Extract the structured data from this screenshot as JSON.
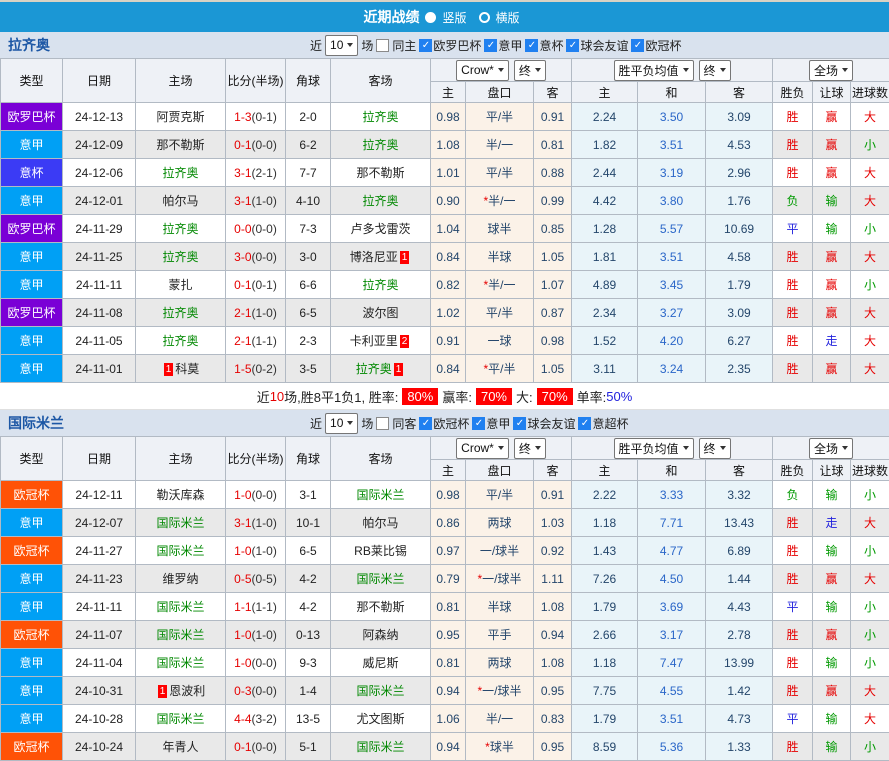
{
  "title_bar": {
    "title": "近期战绩",
    "radios": [
      {
        "label": "竖版",
        "selected": true
      },
      {
        "label": "横版",
        "selected": false
      }
    ]
  },
  "colors": {
    "accent_blue": "#1b97d5",
    "filter_bar_bg": "#d9e2ee",
    "header_bg": "#eef1f6",
    "row_alt_bg": "#e9e9e9",
    "handicap_group_bg": "#fbf2e8",
    "avg_group_bg": "#e9f4f9",
    "team_green": "#008800",
    "win_red": "#e60000",
    "lose_green": "#009900",
    "draw_blue": "#2222dd",
    "league": {
      "欧罗巴杯": "#7a00d6",
      "意甲": "#00a0f5",
      "意杯": "#3b3bf5",
      "欧冠杯": "#ff5206"
    }
  },
  "table_header": {
    "cols": [
      "类型",
      "日期",
      "主场",
      "比分(半场)",
      "角球",
      "客场"
    ],
    "sub": [
      "主",
      "盘口",
      "客",
      "主",
      "和",
      "客",
      "胜负",
      "让球",
      "进球数"
    ],
    "dropdowns": {
      "odds_source": "Crow*",
      "odds_time": "终",
      "avg": "胜平负均值",
      "avg_time": "终",
      "scope": "全场"
    }
  },
  "sections": [
    {
      "team": "拉齐奥",
      "filter": {
        "near_label": "近",
        "count": "10",
        "unit": "场",
        "same_label": "同主",
        "same_checked": false,
        "competitions": [
          {
            "label": "欧罗巴杯",
            "checked": true
          },
          {
            "label": "意甲",
            "checked": true
          },
          {
            "label": "意杯",
            "checked": true
          },
          {
            "label": "球会友谊",
            "checked": true
          },
          {
            "label": "欧冠杯",
            "checked": true
          }
        ]
      },
      "rows": [
        {
          "league": "欧罗巴杯",
          "date": "24-12-13",
          "home": {
            "name": "阿贾克斯"
          },
          "score": "1-3",
          "half": "(0-1)",
          "corner": "2-0",
          "away": {
            "name": "拉齐奥",
            "green": true
          },
          "crow": [
            "0.98",
            "平/半",
            "0.91"
          ],
          "star": false,
          "europe": [
            "2.24",
            "3.50",
            "3.09"
          ],
          "res": [
            {
              "t": "胜",
              "c": "cr"
            },
            {
              "t": "赢",
              "c": "cr"
            },
            {
              "t": "大",
              "c": "cr"
            }
          ]
        },
        {
          "league": "意甲",
          "date": "24-12-09",
          "home": {
            "name": "那不勒斯"
          },
          "score": "0-1",
          "half": "(0-0)",
          "corner": "6-2",
          "away": {
            "name": "拉齐奥",
            "green": true
          },
          "crow": [
            "1.08",
            "半/一",
            "0.81"
          ],
          "star": false,
          "europe": [
            "1.82",
            "3.51",
            "4.53"
          ],
          "res": [
            {
              "t": "胜",
              "c": "cr"
            },
            {
              "t": "赢",
              "c": "cr"
            },
            {
              "t": "小",
              "c": "cg"
            }
          ]
        },
        {
          "league": "意杯",
          "date": "24-12-06",
          "home": {
            "name": "拉齐奥",
            "green": true
          },
          "score": "3-1",
          "half": "(2-1)",
          "corner": "7-7",
          "away": {
            "name": "那不勒斯"
          },
          "crow": [
            "1.01",
            "平/半",
            "0.88"
          ],
          "star": false,
          "europe": [
            "2.44",
            "3.19",
            "2.96"
          ],
          "res": [
            {
              "t": "胜",
              "c": "cr"
            },
            {
              "t": "赢",
              "c": "cr"
            },
            {
              "t": "大",
              "c": "cr"
            }
          ]
        },
        {
          "league": "意甲",
          "date": "24-12-01",
          "home": {
            "name": "帕尔马"
          },
          "score": "3-1",
          "half": "(1-0)",
          "corner": "4-10",
          "away": {
            "name": "拉齐奥",
            "green": true
          },
          "crow": [
            "0.90",
            "半/一",
            "0.99"
          ],
          "star": true,
          "europe": [
            "4.42",
            "3.80",
            "1.76"
          ],
          "res": [
            {
              "t": "负",
              "c": "cg"
            },
            {
              "t": "输",
              "c": "cg"
            },
            {
              "t": "大",
              "c": "cr"
            }
          ]
        },
        {
          "league": "欧罗巴杯",
          "date": "24-11-29",
          "home": {
            "name": "拉齐奥",
            "green": true
          },
          "score": "0-0",
          "half": "(0-0)",
          "corner": "7-3",
          "away": {
            "name": "卢多戈雷茨"
          },
          "crow": [
            "1.04",
            "球半",
            "0.85"
          ],
          "star": false,
          "europe": [
            "1.28",
            "5.57",
            "10.69"
          ],
          "res": [
            {
              "t": "平",
              "c": "cb2"
            },
            {
              "t": "输",
              "c": "cg"
            },
            {
              "t": "小",
              "c": "cg"
            }
          ]
        },
        {
          "league": "意甲",
          "date": "24-11-25",
          "home": {
            "name": "拉齐奥",
            "green": true
          },
          "score": "3-0",
          "half": "(0-0)",
          "corner": "3-0",
          "away": {
            "name": "博洛尼亚",
            "badge": "1",
            "badge_side": "right"
          },
          "crow": [
            "0.84",
            "半球",
            "1.05"
          ],
          "star": false,
          "europe": [
            "1.81",
            "3.51",
            "4.58"
          ],
          "res": [
            {
              "t": "胜",
              "c": "cr"
            },
            {
              "t": "赢",
              "c": "cr"
            },
            {
              "t": "大",
              "c": "cr"
            }
          ]
        },
        {
          "league": "意甲",
          "date": "24-11-11",
          "home": {
            "name": "蒙扎"
          },
          "score": "0-1",
          "half": "(0-1)",
          "corner": "6-6",
          "away": {
            "name": "拉齐奥",
            "green": true
          },
          "crow": [
            "0.82",
            "半/一",
            "1.07"
          ],
          "star": true,
          "europe": [
            "4.89",
            "3.45",
            "1.79"
          ],
          "res": [
            {
              "t": "胜",
              "c": "cr"
            },
            {
              "t": "赢",
              "c": "cr"
            },
            {
              "t": "小",
              "c": "cg"
            }
          ]
        },
        {
          "league": "欧罗巴杯",
          "date": "24-11-08",
          "home": {
            "name": "拉齐奥",
            "green": true
          },
          "score": "2-1",
          "half": "(1-0)",
          "corner": "6-5",
          "away": {
            "name": "波尔图"
          },
          "crow": [
            "1.02",
            "平/半",
            "0.87"
          ],
          "star": false,
          "europe": [
            "2.34",
            "3.27",
            "3.09"
          ],
          "res": [
            {
              "t": "胜",
              "c": "cr"
            },
            {
              "t": "赢",
              "c": "cr"
            },
            {
              "t": "大",
              "c": "cr"
            }
          ]
        },
        {
          "league": "意甲",
          "date": "24-11-05",
          "home": {
            "name": "拉齐奥",
            "green": true
          },
          "score": "2-1",
          "half": "(1-1)",
          "corner": "2-3",
          "away": {
            "name": "卡利亚里",
            "badge": "2",
            "badge_side": "right"
          },
          "crow": [
            "0.91",
            "一球",
            "0.98"
          ],
          "star": false,
          "europe": [
            "1.52",
            "4.20",
            "6.27"
          ],
          "res": [
            {
              "t": "胜",
              "c": "cr"
            },
            {
              "t": "走",
              "c": "cb2"
            },
            {
              "t": "大",
              "c": "cr"
            }
          ]
        },
        {
          "league": "意甲",
          "date": "24-11-01",
          "home": {
            "name": "科莫",
            "badge": "1",
            "badge_side": "left"
          },
          "score": "1-5",
          "half": "(0-2)",
          "corner": "3-5",
          "away": {
            "name": "拉齐奥",
            "green": true,
            "badge": "1",
            "badge_side": "right"
          },
          "crow": [
            "0.84",
            "平/半",
            "1.05"
          ],
          "star": true,
          "europe": [
            "3.11",
            "3.24",
            "2.35"
          ],
          "res": [
            {
              "t": "胜",
              "c": "cr"
            },
            {
              "t": "赢",
              "c": "cr"
            },
            {
              "t": "大",
              "c": "cr"
            }
          ]
        }
      ],
      "summary": {
        "parts": [
          {
            "t": "近",
            "c": "k"
          },
          {
            "t": "10",
            "c": "r"
          },
          {
            "t": "场,胜8平1负1, 胜率:",
            "c": "k"
          },
          {
            "t": "80%",
            "c": "badge"
          },
          {
            "t": "赢率:",
            "c": "k"
          },
          {
            "t": "70%",
            "c": "badge"
          },
          {
            "t": "大:",
            "c": "k"
          },
          {
            "t": "70%",
            "c": "badge"
          },
          {
            "t": "单率:",
            "c": "k"
          },
          {
            "t": "50%",
            "c": "b"
          }
        ]
      }
    },
    {
      "team": "国际米兰",
      "filter": {
        "near_label": "近",
        "count": "10",
        "unit": "场",
        "same_label": "同客",
        "same_checked": false,
        "competitions": [
          {
            "label": "欧冠杯",
            "checked": true
          },
          {
            "label": "意甲",
            "checked": true
          },
          {
            "label": "球会友谊",
            "checked": true
          },
          {
            "label": "意超杯",
            "checked": true
          }
        ]
      },
      "rows": [
        {
          "league": "欧冠杯",
          "date": "24-12-11",
          "home": {
            "name": "勒沃库森"
          },
          "score": "1-0",
          "half": "(0-0)",
          "corner": "3-1",
          "away": {
            "name": "国际米兰",
            "green": true
          },
          "crow": [
            "0.98",
            "平/半",
            "0.91"
          ],
          "star": false,
          "europe": [
            "2.22",
            "3.33",
            "3.32"
          ],
          "res": [
            {
              "t": "负",
              "c": "cg"
            },
            {
              "t": "输",
              "c": "cg"
            },
            {
              "t": "小",
              "c": "cg"
            }
          ]
        },
        {
          "league": "意甲",
          "date": "24-12-07",
          "home": {
            "name": "国际米兰",
            "green": true
          },
          "score": "3-1",
          "half": "(1-0)",
          "corner": "10-1",
          "away": {
            "name": "帕尔马"
          },
          "crow": [
            "0.86",
            "两球",
            "1.03"
          ],
          "star": false,
          "europe": [
            "1.18",
            "7.71",
            "13.43"
          ],
          "res": [
            {
              "t": "胜",
              "c": "cr"
            },
            {
              "t": "走",
              "c": "cb2"
            },
            {
              "t": "大",
              "c": "cr"
            }
          ]
        },
        {
          "league": "欧冠杯",
          "date": "24-11-27",
          "home": {
            "name": "国际米兰",
            "green": true
          },
          "score": "1-0",
          "half": "(1-0)",
          "corner": "6-5",
          "away": {
            "name": "RB莱比锡"
          },
          "crow": [
            "0.97",
            "一/球半",
            "0.92"
          ],
          "star": false,
          "europe": [
            "1.43",
            "4.77",
            "6.89"
          ],
          "res": [
            {
              "t": "胜",
              "c": "cr"
            },
            {
              "t": "输",
              "c": "cg"
            },
            {
              "t": "小",
              "c": "cg"
            }
          ]
        },
        {
          "league": "意甲",
          "date": "24-11-23",
          "home": {
            "name": "维罗纳"
          },
          "score": "0-5",
          "half": "(0-5)",
          "corner": "4-2",
          "away": {
            "name": "国际米兰",
            "green": true
          },
          "crow": [
            "0.79",
            "一/球半",
            "1.11"
          ],
          "star": true,
          "europe": [
            "7.26",
            "4.50",
            "1.44"
          ],
          "res": [
            {
              "t": "胜",
              "c": "cr"
            },
            {
              "t": "赢",
              "c": "cr"
            },
            {
              "t": "大",
              "c": "cr"
            }
          ]
        },
        {
          "league": "意甲",
          "date": "24-11-11",
          "home": {
            "name": "国际米兰",
            "green": true
          },
          "score": "1-1",
          "half": "(1-1)",
          "corner": "4-2",
          "away": {
            "name": "那不勒斯"
          },
          "crow": [
            "0.81",
            "半球",
            "1.08"
          ],
          "star": false,
          "europe": [
            "1.79",
            "3.69",
            "4.43"
          ],
          "res": [
            {
              "t": "平",
              "c": "cb2"
            },
            {
              "t": "输",
              "c": "cg"
            },
            {
              "t": "小",
              "c": "cg"
            }
          ]
        },
        {
          "league": "欧冠杯",
          "date": "24-11-07",
          "home": {
            "name": "国际米兰",
            "green": true
          },
          "score": "1-0",
          "half": "(1-0)",
          "corner": "0-13",
          "away": {
            "name": "阿森纳"
          },
          "crow": [
            "0.95",
            "平手",
            "0.94"
          ],
          "star": false,
          "europe": [
            "2.66",
            "3.17",
            "2.78"
          ],
          "res": [
            {
              "t": "胜",
              "c": "cr"
            },
            {
              "t": "赢",
              "c": "cr"
            },
            {
              "t": "小",
              "c": "cg"
            }
          ]
        },
        {
          "league": "意甲",
          "date": "24-11-04",
          "home": {
            "name": "国际米兰",
            "green": true
          },
          "score": "1-0",
          "half": "(0-0)",
          "corner": "9-3",
          "away": {
            "name": "威尼斯"
          },
          "crow": [
            "0.81",
            "两球",
            "1.08"
          ],
          "star": false,
          "europe": [
            "1.18",
            "7.47",
            "13.99"
          ],
          "res": [
            {
              "t": "胜",
              "c": "cr"
            },
            {
              "t": "输",
              "c": "cg"
            },
            {
              "t": "小",
              "c": "cg"
            }
          ]
        },
        {
          "league": "意甲",
          "date": "24-10-31",
          "home": {
            "name": "恩波利",
            "badge": "1",
            "badge_side": "left"
          },
          "score": "0-3",
          "half": "(0-0)",
          "corner": "1-4",
          "away": {
            "name": "国际米兰",
            "green": true
          },
          "crow": [
            "0.94",
            "一/球半",
            "0.95"
          ],
          "star": true,
          "europe": [
            "7.75",
            "4.55",
            "1.42"
          ],
          "res": [
            {
              "t": "胜",
              "c": "cr"
            },
            {
              "t": "赢",
              "c": "cr"
            },
            {
              "t": "大",
              "c": "cr"
            }
          ]
        },
        {
          "league": "意甲",
          "date": "24-10-28",
          "home": {
            "name": "国际米兰",
            "green": true
          },
          "score": "4-4",
          "half": "(3-2)",
          "corner": "13-5",
          "away": {
            "name": "尤文图斯"
          },
          "crow": [
            "1.06",
            "半/一",
            "0.83"
          ],
          "star": false,
          "europe": [
            "1.79",
            "3.51",
            "4.73"
          ],
          "res": [
            {
              "t": "平",
              "c": "cb2"
            },
            {
              "t": "输",
              "c": "cg"
            },
            {
              "t": "大",
              "c": "cr"
            }
          ]
        },
        {
          "league": "欧冠杯",
          "date": "24-10-24",
          "home": {
            "name": "年青人"
          },
          "score": "0-1",
          "half": "(0-0)",
          "corner": "5-1",
          "away": {
            "name": "国际米兰",
            "green": true
          },
          "crow": [
            "0.94",
            "球半",
            "0.95"
          ],
          "star": true,
          "europe": [
            "8.59",
            "5.36",
            "1.33"
          ],
          "res": [
            {
              "t": "胜",
              "c": "cr"
            },
            {
              "t": "输",
              "c": "cg"
            },
            {
              "t": "小",
              "c": "cg"
            }
          ]
        }
      ]
    }
  ]
}
